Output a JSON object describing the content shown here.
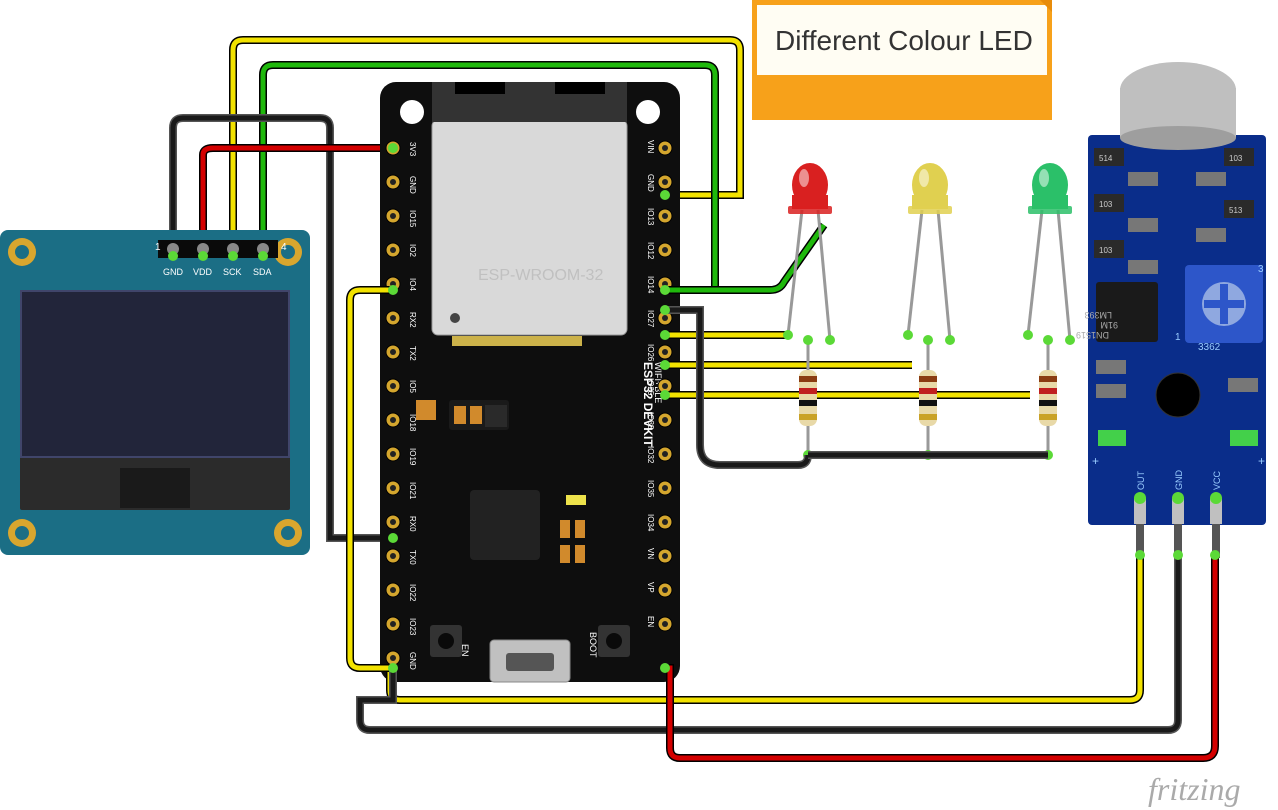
{
  "note": {
    "text": "Different Colour LED"
  },
  "watermark": "fritzing",
  "oled": {
    "pin_left_num": "1",
    "pin_right_num": "4",
    "pins": [
      "GND",
      "VDD",
      "SCK",
      "SDA"
    ]
  },
  "esp32": {
    "name_line1": "ESP32 DEVKIT",
    "name_line2": "WIFI+BLE",
    "chip_label": "ESP-WROOM-32",
    "left_pins": [
      "3V3",
      "GND",
      "IO15",
      "IO2",
      "IO4",
      "RX2",
      "TX2",
      "IO5",
      "IO18",
      "IO19",
      "IO21",
      "RX0",
      "TX0",
      "IO22",
      "IO23",
      "GND"
    ],
    "right_pins": [
      "VIN",
      "GND",
      "IO13",
      "IO12",
      "IO14",
      "IO27",
      "IO26",
      "IO25",
      "IO33",
      "IO32",
      "IO35",
      "IO34",
      "VN",
      "VP",
      "EN"
    ],
    "boot": "BOOT",
    "en": "EN"
  },
  "leds": {
    "colors": [
      "red",
      "yellow",
      "green"
    ]
  },
  "sound_sensor": {
    "pins": [
      "OUT",
      "GND",
      "VCC"
    ],
    "chip_label1": "LM393",
    "chip_label2": "91M",
    "chip_label3": "DN1519",
    "pot_label_left": "1",
    "pot_label_right": "3",
    "pot_label_mid": "3362"
  }
}
